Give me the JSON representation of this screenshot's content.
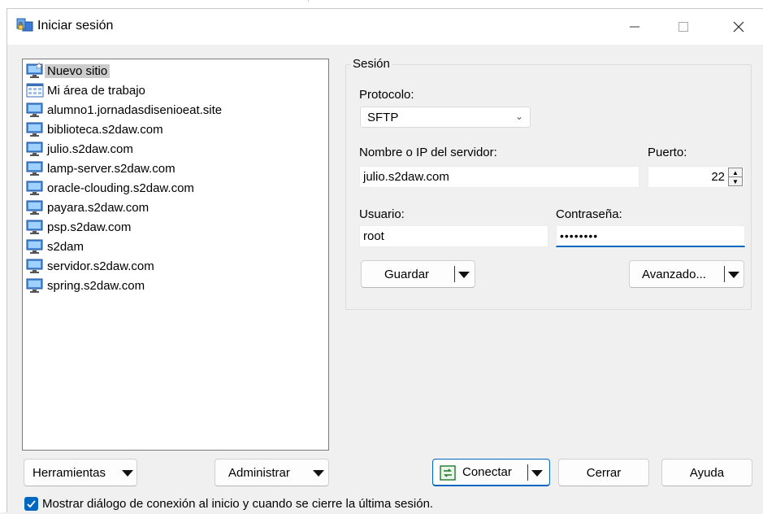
{
  "window": {
    "title": "Iniciar sesión",
    "controls": [
      "minimize",
      "maximize",
      "close"
    ]
  },
  "sites": [
    {
      "label": "Nuevo sitio",
      "icon": "new-site-icon",
      "selected": true
    },
    {
      "label": "Mi área de trabajo",
      "icon": "workspace-icon"
    },
    {
      "label": "alumno1.jornadasdisenioeat.site",
      "icon": "computer-icon"
    },
    {
      "label": "biblioteca.s2daw.com",
      "icon": "computer-icon"
    },
    {
      "label": "julio.s2daw.com",
      "icon": "computer-icon"
    },
    {
      "label": "lamp-server.s2daw.com",
      "icon": "computer-icon"
    },
    {
      "label": "oracle-clouding.s2daw.com",
      "icon": "computer-icon"
    },
    {
      "label": "payara.s2daw.com",
      "icon": "computer-icon"
    },
    {
      "label": "psp.s2daw.com",
      "icon": "computer-icon"
    },
    {
      "label": "s2dam",
      "icon": "computer-icon"
    },
    {
      "label": "servidor.s2daw.com",
      "icon": "computer-icon"
    },
    {
      "label": "spring.s2daw.com",
      "icon": "computer-icon"
    }
  ],
  "session": {
    "legend": "Sesión",
    "protocol_label": "Protocolo:",
    "protocol_value": "SFTP",
    "host_label": "Nombre o IP del servidor:",
    "host_value": "julio.s2daw.com",
    "port_label": "Puerto:",
    "port_value": "22",
    "user_label": "Usuario:",
    "user_value": "root",
    "password_label": "Contraseña:",
    "password_value": "••••••••",
    "save_label": "Guardar",
    "advanced_label": "Avanzado..."
  },
  "footer": {
    "tools_label": "Herramientas",
    "manage_label": "Administrar",
    "connect_label": "Conectar",
    "close_label": "Cerrar",
    "help_label": "Ayuda",
    "checkbox_label": "Mostrar diálogo de conexión al inicio y cuando se cierre la última sesión.",
    "checkbox_checked": true
  },
  "colors": {
    "accent": "#0067c0",
    "window_bg": "#f0f0f0",
    "titlebar_bg": "#ffffff"
  }
}
